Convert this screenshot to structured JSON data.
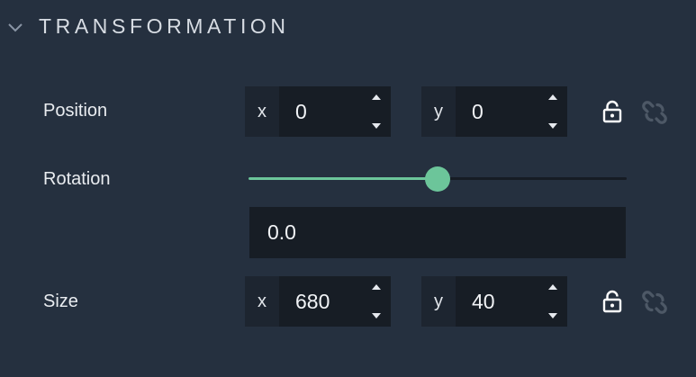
{
  "section": {
    "title": "TRANSFORMATION",
    "collapse_icon": "chevron-down-icon"
  },
  "position": {
    "label": "Position",
    "x": {
      "axis": "x",
      "value": "0"
    },
    "y": {
      "axis": "y",
      "value": "0"
    },
    "lock_icon": "lock-open-icon",
    "link_icon": "link-icon"
  },
  "rotation": {
    "label": "Rotation",
    "slider_fraction": 0.5,
    "value": "0.0"
  },
  "size": {
    "label": "Size",
    "x": {
      "axis": "x",
      "value": "680"
    },
    "y": {
      "axis": "y",
      "value": "40"
    },
    "lock_icon": "lock-open-icon",
    "link_icon": "link-icon"
  },
  "colors": {
    "background": "#25303f",
    "field": "#171d25",
    "accent": "#6cc59a"
  }
}
